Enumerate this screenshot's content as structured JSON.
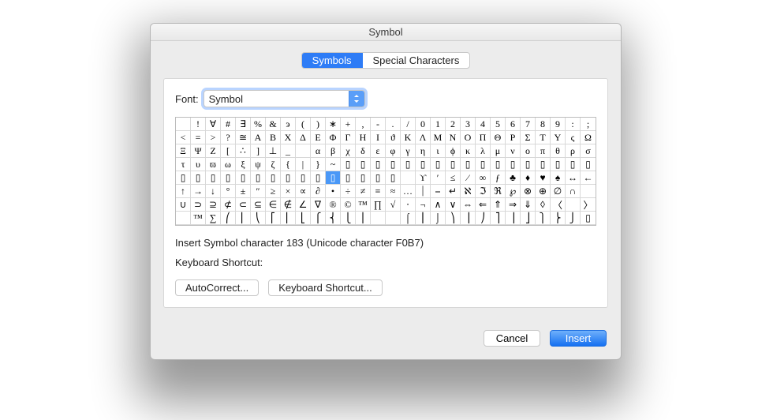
{
  "window": {
    "title": "Symbol"
  },
  "tabs": {
    "symbols": "Symbols",
    "special": "Special Characters"
  },
  "font": {
    "label": "Font:",
    "value": "Symbol"
  },
  "grid": {
    "selected_index": 122,
    "rows": [
      [
        "",
        "!",
        "∀",
        "#",
        "∃",
        "%",
        "&",
        "э",
        "(",
        ")",
        "∗",
        "+",
        ",",
        "-",
        ".",
        "/",
        "0",
        "1",
        "2",
        "3",
        "4",
        "5",
        "6",
        "7",
        "8",
        "9",
        ":",
        ";"
      ],
      [
        "<",
        "=",
        ">",
        "?",
        "≅",
        "Α",
        "Β",
        "Χ",
        "Δ",
        "Ε",
        "Φ",
        "Γ",
        "Η",
        "Ι",
        "ϑ",
        "Κ",
        "Λ",
        "Μ",
        "Ν",
        "Ο",
        "Π",
        "Θ",
        "Ρ",
        "Σ",
        "Τ",
        "Υ",
        "ς",
        "Ω"
      ],
      [
        "Ξ",
        "Ψ",
        "Ζ",
        "[",
        "∴",
        "]",
        "⊥",
        "_",
        "",
        "α",
        "β",
        "χ",
        "δ",
        "ε",
        "φ",
        "γ",
        "η",
        "ι",
        "ϕ",
        "κ",
        "λ",
        "μ",
        "ν",
        "ο",
        "π",
        "θ",
        "ρ",
        "σ"
      ],
      [
        "τ",
        "υ",
        "ϖ",
        "ω",
        "ξ",
        "ψ",
        "ζ",
        "{",
        "|",
        "}",
        "~",
        "▯",
        "▯",
        "▯",
        "▯",
        "▯",
        "▯",
        "▯",
        "▯",
        "▯",
        "▯",
        "▯",
        "▯",
        "▯",
        "▯",
        "▯",
        "▯",
        "▯"
      ],
      [
        "▯",
        "▯",
        "▯",
        "▯",
        "▯",
        "▯",
        "▯",
        "▯",
        "▯",
        "▯",
        "▯",
        "▯",
        "▯",
        "▯",
        "▯",
        "",
        "ϒ",
        "′",
        "≤",
        "⁄",
        "∞",
        "ƒ",
        "♣",
        "♦",
        "♥",
        "♠",
        "↔",
        "←"
      ],
      [
        "↑",
        "→",
        "↓",
        "°",
        "±",
        "″",
        "≥",
        "×",
        "∝",
        "∂",
        "•",
        "÷",
        "≠",
        "≡",
        "≈",
        "…",
        "⏐",
        "⎯",
        "↵",
        "ℵ",
        "ℑ",
        "ℜ",
        "℘",
        "⊗",
        "⊕",
        "∅",
        "∩",
        ""
      ],
      [
        "∪",
        "⊃",
        "⊇",
        "⊄",
        "⊂",
        "⊆",
        "∈",
        "∉",
        "∠",
        "∇",
        "®",
        "©",
        "™",
        "∏",
        "√",
        "⋅",
        "¬",
        "∧",
        "∨",
        "⇔",
        "⇐",
        "⇑",
        "⇒",
        "⇓",
        "◊",
        "〈",
        "",
        "〉"
      ],
      [
        "",
        "™",
        "∑",
        "⎛",
        "⎜",
        "⎝",
        "⎡",
        "⎢",
        "⎣",
        "⎧",
        "⎨",
        "⎩",
        "⎪",
        "",
        "",
        "⌠",
        "⎮",
        "⌡",
        "⎞",
        "⎟",
        "⎠",
        "⎤",
        "⎥",
        "⎦",
        "⎫",
        "⎬",
        "⎭",
        "▯"
      ]
    ]
  },
  "info": {
    "desc": "Insert Symbol character 183  (Unicode character F0B7)",
    "shortcut_label": "Keyboard Shortcut:"
  },
  "buttons": {
    "autocorrect": "AutoCorrect...",
    "shortcut": "Keyboard Shortcut...",
    "cancel": "Cancel",
    "insert": "Insert"
  }
}
